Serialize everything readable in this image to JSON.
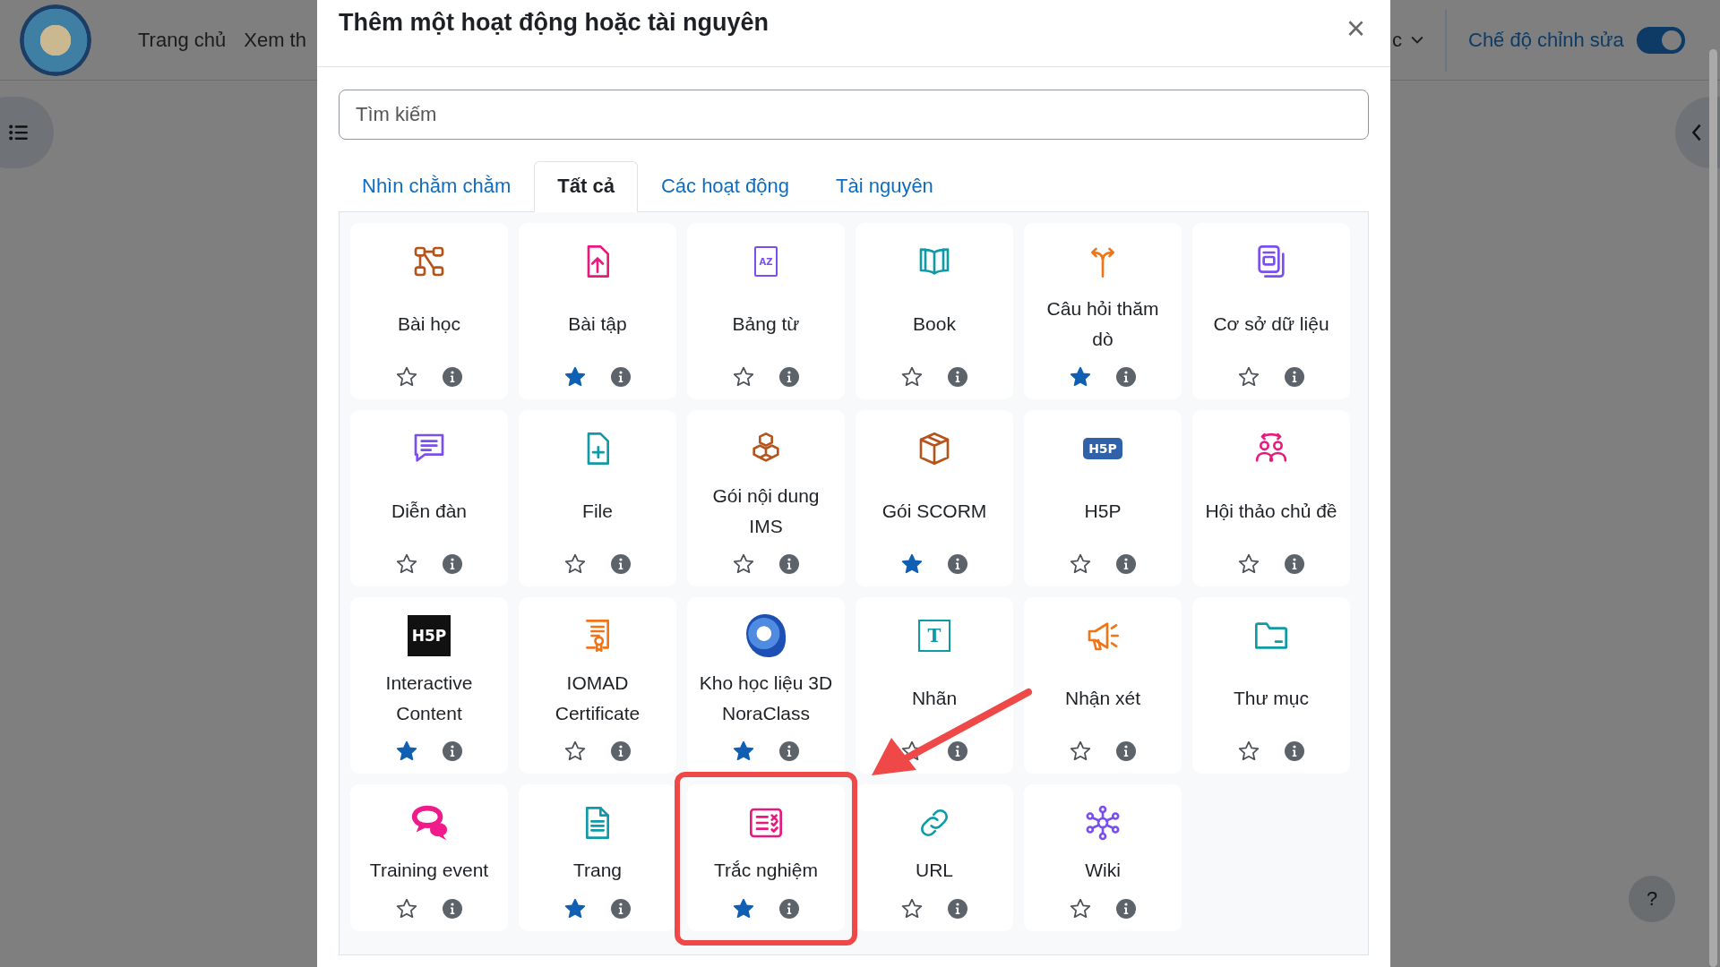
{
  "header": {
    "nav": [
      "Trang chủ",
      "Xem th"
    ],
    "menu_fragment": "c",
    "edit_mode": {
      "label": "Chế độ chỉnh sửa",
      "on": true
    }
  },
  "modal": {
    "title": "Thêm một hoạt động hoặc tài nguyên",
    "close": "×",
    "search": {
      "placeholder": "Tìm kiếm"
    },
    "tabs": [
      {
        "label": "Nhìn chằm chằm",
        "selected": false
      },
      {
        "label": "Tất cả",
        "selected": true
      },
      {
        "label": "Các hoạt động",
        "selected": false
      },
      {
        "label": "Tài nguyên",
        "selected": false
      }
    ],
    "items": [
      {
        "label": "Bài học",
        "kind": "lesson",
        "starred": false
      },
      {
        "label": "Bài tập",
        "kind": "assignment",
        "starred": true
      },
      {
        "label": "Bảng từ",
        "kind": "glossary",
        "icon_text": "AZ",
        "starred": false
      },
      {
        "label": "Book",
        "kind": "book",
        "starred": false
      },
      {
        "label": "Câu hỏi thăm dò",
        "kind": "feedback",
        "starred": true
      },
      {
        "label": "Cơ sở dữ liệu",
        "kind": "database",
        "starred": false
      },
      {
        "label": "Diễn đàn",
        "kind": "forum",
        "starred": false
      },
      {
        "label": "File",
        "kind": "file",
        "starred": false
      },
      {
        "label": "Gói nội dung IMS",
        "kind": "ims",
        "starred": false
      },
      {
        "label": "Gói SCORM",
        "kind": "scorm",
        "starred": true
      },
      {
        "label": "H5P",
        "kind": "h5p",
        "icon_text": "H5P",
        "starred": false
      },
      {
        "label": "Hội thảo chủ đề",
        "kind": "workshop",
        "starred": false
      },
      {
        "label": "Interactive Content",
        "kind": "interactive",
        "icon_text": "H5P",
        "starred": true
      },
      {
        "label": "IOMAD Certificate",
        "kind": "certificate",
        "starred": false
      },
      {
        "label": "Kho học liệu 3D NoraClass",
        "kind": "swirl",
        "starred": true
      },
      {
        "label": "Nhãn",
        "kind": "label",
        "icon_text": "T",
        "starred": false
      },
      {
        "label": "Nhận xét",
        "kind": "comment",
        "starred": false
      },
      {
        "label": "Thư mục",
        "kind": "folder",
        "starred": false
      },
      {
        "label": "Training event",
        "kind": "training",
        "starred": false
      },
      {
        "label": "Trang",
        "kind": "page",
        "starred": true
      },
      {
        "label": "Trắc nghiệm",
        "kind": "quiz",
        "starred": true,
        "highlighted": true
      },
      {
        "label": "URL",
        "kind": "url",
        "starred": false
      },
      {
        "label": "Wiki",
        "kind": "wiki",
        "starred": false
      }
    ]
  },
  "help": "?"
}
